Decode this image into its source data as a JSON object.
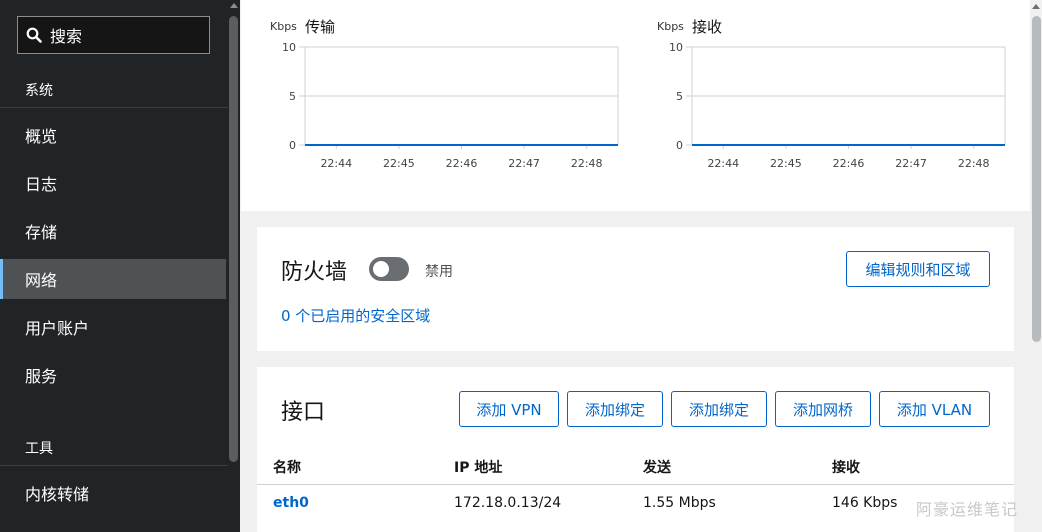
{
  "sidebar": {
    "search_label": "搜索",
    "section_system": "系统",
    "items": [
      {
        "label": "概览"
      },
      {
        "label": "日志"
      },
      {
        "label": "存储"
      },
      {
        "label": "网络"
      },
      {
        "label": "用户账户"
      },
      {
        "label": "服务"
      }
    ],
    "section_tools": "工具",
    "tools_items": [
      {
        "label": "内核转储"
      }
    ]
  },
  "charts": [
    {
      "unit": "Kbps",
      "title": "传输"
    },
    {
      "unit": "Kbps",
      "title": "接收"
    }
  ],
  "chart_data": [
    {
      "type": "line",
      "title": "传输",
      "ylabel": "Kbps",
      "yticks": [
        "0",
        "5",
        "10"
      ],
      "ylim": [
        0,
        10
      ],
      "categories": [
        "22:44",
        "22:45",
        "22:46",
        "22:47",
        "22:48"
      ],
      "series": [
        {
          "values": [
            0,
            0,
            0,
            0,
            0,
            0
          ]
        }
      ],
      "line_color": "#06c",
      "grid": true
    },
    {
      "type": "line",
      "title": "接收",
      "ylabel": "Kbps",
      "yticks": [
        "0",
        "5",
        "10"
      ],
      "ylim": [
        0,
        10
      ],
      "categories": [
        "22:44",
        "22:45",
        "22:46",
        "22:47",
        "22:48"
      ],
      "series": [
        {
          "values": [
            0,
            0,
            0,
            0,
            0,
            0
          ]
        }
      ],
      "line_color": "#06c",
      "grid": true
    }
  ],
  "firewall": {
    "title": "防火墙",
    "status": "禁用",
    "enabled": false,
    "edit_button": "编辑规则和区域",
    "zones_link": "0 个已启用的安全区域"
  },
  "interfaces": {
    "title": "接口",
    "buttons": [
      "添加 VPN",
      "添加绑定",
      "添加绑定",
      "添加网桥",
      "添加 VLAN"
    ],
    "columns": [
      "名称",
      "IP 地址",
      "发送",
      "接收"
    ],
    "rows": [
      {
        "name": "eth0",
        "ip": "172.18.0.13/24",
        "send": "1.55 Mbps",
        "recv": "146 Kbps"
      }
    ]
  },
  "watermark": "阿豪运维笔记",
  "colors": {
    "accent": "#06c",
    "sidebar_bg": "#212427",
    "active_indicator": "#73bcf7"
  }
}
